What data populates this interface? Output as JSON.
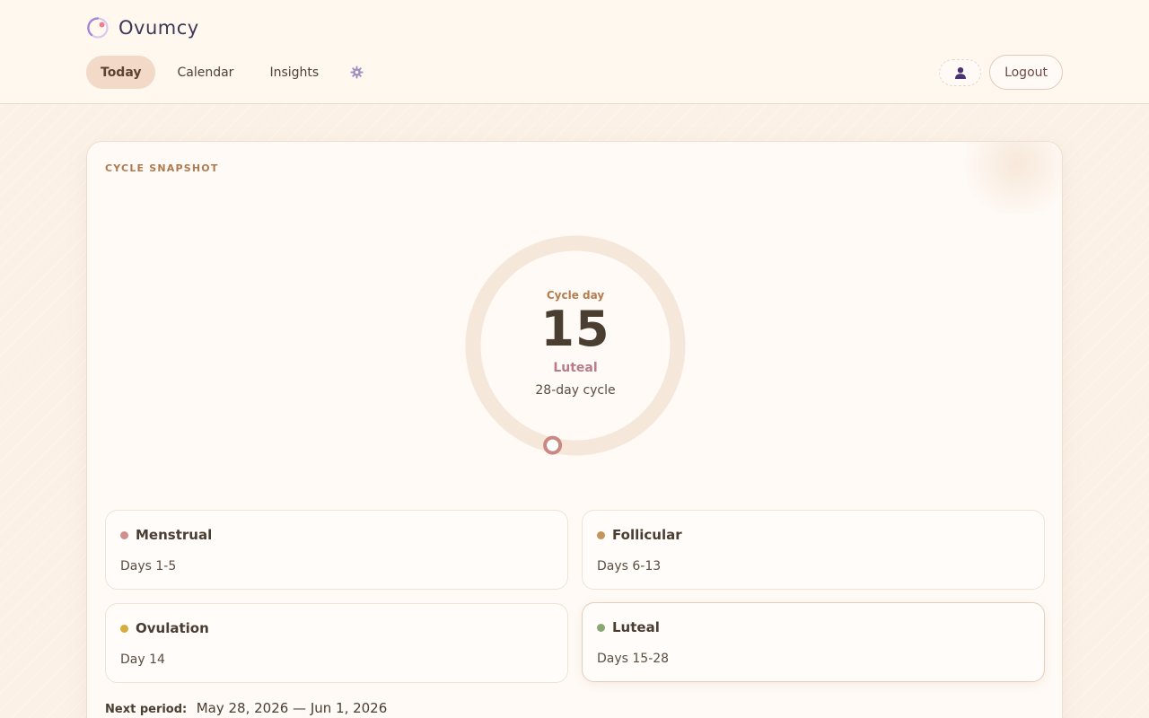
{
  "brand": {
    "name": "Ovumcy"
  },
  "nav": {
    "tabs": [
      {
        "label": "Today",
        "active": true
      },
      {
        "label": "Calendar",
        "active": false
      },
      {
        "label": "Insights",
        "active": false
      }
    ]
  },
  "header": {
    "logout_label": "Logout"
  },
  "snapshot": {
    "section_label": "CYCLE SNAPSHOT",
    "cycle_day_label": "Cycle day",
    "cycle_day": "15",
    "phase_name": "Luteal",
    "cycle_length": "28-day cycle",
    "progress_day": 15,
    "progress_total": 28
  },
  "phases": [
    {
      "name": "Menstrual",
      "days": "Days 1-5",
      "color": "#d08f8d",
      "current": false
    },
    {
      "name": "Follicular",
      "days": "Days 6-13",
      "color": "#c4955a",
      "current": false
    },
    {
      "name": "Ovulation",
      "days": "Day 14",
      "color": "#d5ad3f",
      "current": false
    },
    {
      "name": "Luteal",
      "days": "Days 15-28",
      "color": "#8aa873",
      "current": true
    }
  ],
  "next_period": {
    "label": "Next period:",
    "value": "May 28, 2026 — Jun 1, 2026"
  },
  "colors": {
    "accent": "#f2d9c8",
    "ring_track": "#f5e8da",
    "ring_marker": "#c98882",
    "brand_text": "#3e3656"
  }
}
